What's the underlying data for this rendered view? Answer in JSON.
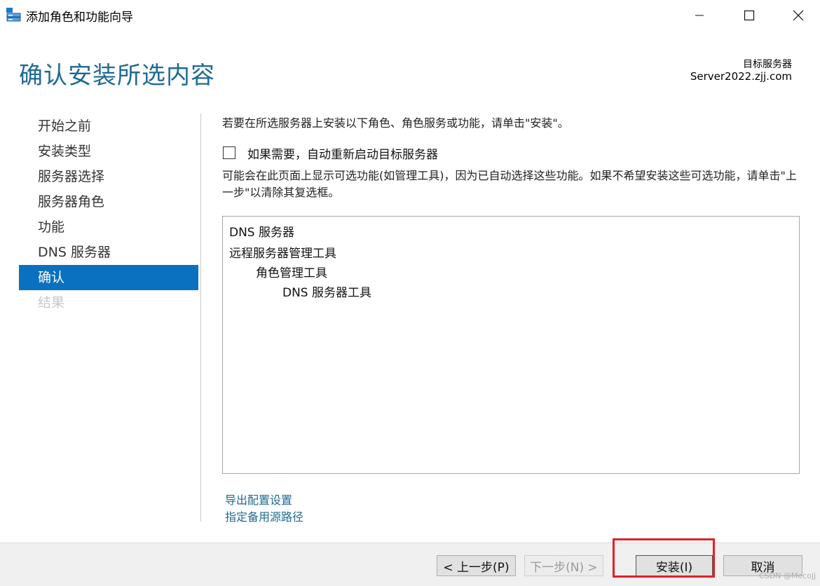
{
  "window": {
    "title": "添加角色和功能向导",
    "icon": "server-manager-icon",
    "controls": [
      "minimize-icon",
      "maximize-icon",
      "close-icon"
    ]
  },
  "header": {
    "page_title": "确认安装所选内容",
    "target_label": "目标服务器",
    "target_value": "Server2022.zjj.com"
  },
  "nav": {
    "items": [
      {
        "label": "开始之前",
        "state": "normal"
      },
      {
        "label": "安装类型",
        "state": "normal"
      },
      {
        "label": "服务器选择",
        "state": "normal"
      },
      {
        "label": "服务器角色",
        "state": "normal"
      },
      {
        "label": "功能",
        "state": "normal"
      },
      {
        "label": "DNS 服务器",
        "state": "normal"
      },
      {
        "label": "确认",
        "state": "active"
      },
      {
        "label": "结果",
        "state": "disabled"
      }
    ]
  },
  "content": {
    "intro": "若要在所选服务器上安装以下角色、角色服务或功能，请单击\"安装\"。",
    "restart_checkbox": {
      "label": "如果需要，自动重新启动目标服务器",
      "checked": false
    },
    "optional_note": "可能会在此页面上显示可选功能(如管理工具)，因为已自动选择这些功能。如果不希望安装这些可选功能，请单击\"上一步\"以清除其复选框。",
    "selection": [
      {
        "label": "DNS 服务器",
        "level": 0
      },
      {
        "label": "远程服务器管理工具",
        "level": 0
      },
      {
        "label": "角色管理工具",
        "level": 1
      },
      {
        "label": "DNS 服务器工具",
        "level": 2
      }
    ],
    "links": {
      "export": "导出配置设置",
      "alternate_source": "指定备用源路径"
    }
  },
  "footer": {
    "back": "< 上一步(P)",
    "next": "下一步(N) >",
    "install": "安装(I)",
    "cancel": "取消"
  },
  "annotation": {
    "color": "#e0202a"
  },
  "watermark": "CSDN @Mecojj",
  "colors": {
    "accent": "#1f6a93",
    "nav_active": "#0a70c0"
  }
}
